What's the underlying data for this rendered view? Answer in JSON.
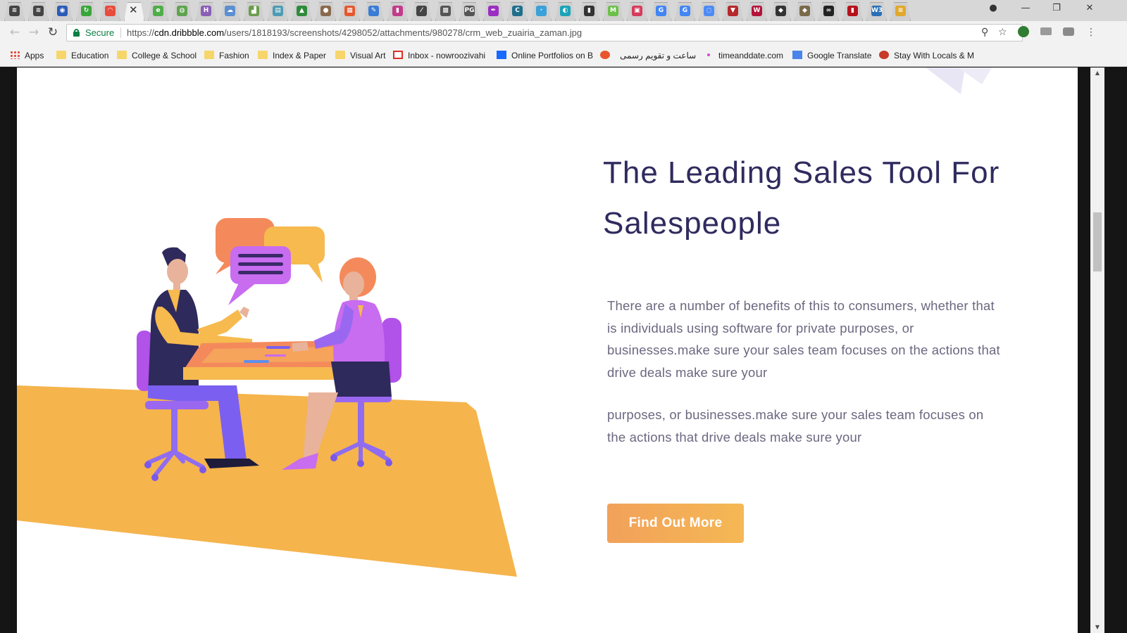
{
  "browser": {
    "tabs": [
      {
        "icon": "menu-lines-icon",
        "color": "#444444",
        "glyph": "≋"
      },
      {
        "icon": "menu-lines-icon",
        "color": "#444444",
        "glyph": "≋"
      },
      {
        "icon": "shield-icon",
        "color": "#2c5bb8",
        "glyph": "◉"
      },
      {
        "icon": "circle-arrow-icon",
        "color": "#3aa63a",
        "glyph": "↻"
      },
      {
        "icon": "rainbow-icon",
        "color": "#e84c3d",
        "glyph": "◠"
      },
      {
        "icon": "close-icon",
        "color": "#333333",
        "glyph": "✕",
        "active": true
      },
      {
        "icon": "leaf-icon",
        "color": "#4fae49",
        "glyph": "e"
      },
      {
        "icon": "globe-icon",
        "color": "#5fa34f",
        "glyph": "◍"
      },
      {
        "icon": "letter-h-icon",
        "color": "#8a5fb5",
        "glyph": "H"
      },
      {
        "icon": "cloud-icon",
        "color": "#5b8fd0",
        "glyph": "☁"
      },
      {
        "icon": "chart-icon",
        "color": "#6a9d4d",
        "glyph": "▟"
      },
      {
        "icon": "document-icon",
        "color": "#4f9bb3",
        "glyph": "▤"
      },
      {
        "icon": "tree-icon",
        "color": "#2f8a3a",
        "glyph": "▲"
      },
      {
        "icon": "avatar-icon",
        "color": "#8a6a4c",
        "glyph": "●"
      },
      {
        "icon": "windows-icon",
        "color": "#e4572e",
        "glyph": "▦"
      },
      {
        "icon": "pen-icon",
        "color": "#3a7bd5",
        "glyph": "✎"
      },
      {
        "icon": "paint-icon",
        "color": "#c23b8a",
        "glyph": "▮"
      },
      {
        "icon": "slash-icon",
        "color": "#444444",
        "glyph": "⁄"
      },
      {
        "icon": "grid-icon",
        "color": "#555555",
        "glyph": "▩"
      },
      {
        "icon": "pg-icon",
        "color": "#555555",
        "glyph": "PG"
      },
      {
        "icon": "quill-icon",
        "color": "#9b2ec0",
        "glyph": "✒"
      },
      {
        "icon": "letter-c-icon",
        "color": "#1f6f8b",
        "glyph": "C"
      },
      {
        "icon": "dot-icon",
        "color": "#3aa1d9",
        "glyph": "·"
      },
      {
        "icon": "pill-icon",
        "color": "#1ba3b8",
        "glyph": "◐"
      },
      {
        "icon": "book-icon",
        "color": "#333333",
        "glyph": "▮"
      },
      {
        "icon": "letter-m-icon",
        "color": "#6cc04a",
        "glyph": "M"
      },
      {
        "icon": "gift-icon",
        "color": "#d63b5c",
        "glyph": "▣"
      },
      {
        "icon": "google-icon",
        "color": "#4285f4",
        "glyph": "G"
      },
      {
        "icon": "google-icon",
        "color": "#4285f4",
        "glyph": "G"
      },
      {
        "icon": "loading-icon",
        "color": "#4c8bf5",
        "glyph": "◌"
      },
      {
        "icon": "crest-icon",
        "color": "#b5282b",
        "glyph": "▼"
      },
      {
        "icon": "letter-w-icon",
        "color": "#b4133a",
        "glyph": "W"
      },
      {
        "icon": "crest-icon",
        "color": "#333333",
        "glyph": "◆"
      },
      {
        "icon": "crest-icon",
        "color": "#7a6a4a",
        "glyph": "◆"
      },
      {
        "icon": "swirl-icon",
        "color": "#222222",
        "glyph": "∞"
      },
      {
        "icon": "bookmark-icon",
        "color": "#b5121b",
        "glyph": "▮"
      },
      {
        "icon": "w3-icon",
        "color": "#2a6fb5",
        "glyph": "W3"
      },
      {
        "icon": "coin-icon",
        "color": "#e0a82e",
        "glyph": "≡"
      }
    ],
    "address": {
      "secure_label": "Secure",
      "url_prefix": "https://",
      "url_host": "cdn.dribbble.com",
      "url_path": "/users/1818193/screenshots/4298052/attachments/980278/crm_web_zuairia_zaman.jpg"
    },
    "bookmarks": [
      {
        "label": "Apps",
        "icon": "apps-grid-icon"
      },
      {
        "label": "Education",
        "icon": "folder-icon"
      },
      {
        "label": "College & School",
        "icon": "folder-icon"
      },
      {
        "label": "Fashion",
        "icon": "folder-icon"
      },
      {
        "label": "Index & Paper",
        "icon": "folder-icon"
      },
      {
        "label": "Visual Art",
        "icon": "folder-icon"
      },
      {
        "label": "Inbox - nowroozivahi",
        "icon": "gmail-icon"
      },
      {
        "label": "Online Portfolios on B",
        "icon": "behance-icon"
      },
      {
        "label": "",
        "icon": "t-circle-icon"
      },
      {
        "label": "ساعت و تقویم رسمی",
        "icon": "none"
      },
      {
        "label": "timeanddate.com",
        "icon": "sparkle-icon"
      },
      {
        "label": "Google Translate",
        "icon": "translate-icon"
      },
      {
        "label": "Stay With Locals & M",
        "icon": "globe-red-icon"
      }
    ]
  },
  "page": {
    "title": "The Leading Sales Tool For Salespeople",
    "paragraph_1": "There are a number of benefits of this to consumers, whether that is individuals using software for private purposes, or businesses.make sure your sales team focuses on the actions that drive deals make sure your",
    "paragraph_2": "purposes, or businesses.make sure your sales team focuses on the actions that drive deals make sure your",
    "cta_label": "Find Out More"
  },
  "colors": {
    "title": "#2f2b5e",
    "body_text": "#6b6880",
    "cta_start": "#f2a15a",
    "cta_end": "#f5b854",
    "floor": "#f5b44c",
    "accent_purple": "#7b5ff0",
    "accent_orange": "#f48a5c"
  }
}
